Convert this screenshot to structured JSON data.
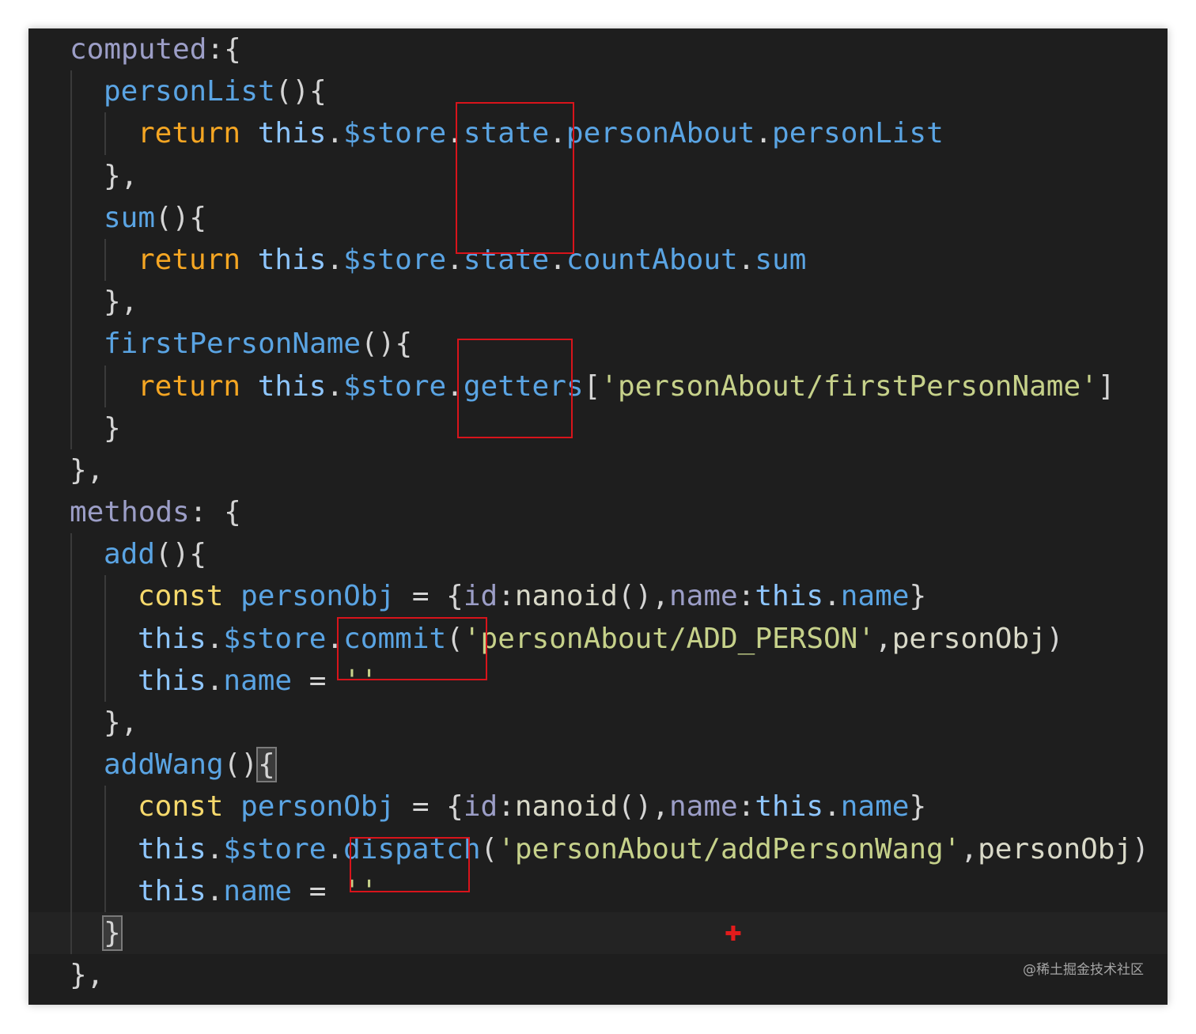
{
  "colors": {
    "editor_background": "#1e1e1e",
    "annotation_box": "#d8141b"
  },
  "code_lines": [
    [
      {
        "t": "computed",
        "c": "kw-prop"
      },
      {
        "t": ":{",
        "c": "punc"
      }
    ],
    [
      {
        "t": "personList",
        "c": "fn"
      },
      {
        "t": "(){",
        "c": "punc"
      }
    ],
    [
      {
        "t": "return",
        "c": "ret"
      },
      {
        "t": " ",
        "c": "punc"
      },
      {
        "t": "this",
        "c": "this"
      },
      {
        "t": ".",
        "c": "punc"
      },
      {
        "t": "$store",
        "c": "var"
      },
      {
        "t": ".",
        "c": "punc"
      },
      {
        "t": "state",
        "c": "var"
      },
      {
        "t": ".",
        "c": "punc"
      },
      {
        "t": "personAbout",
        "c": "var"
      },
      {
        "t": ".",
        "c": "punc"
      },
      {
        "t": "personList",
        "c": "var"
      }
    ],
    [
      {
        "t": "},",
        "c": "punc"
      }
    ],
    [
      {
        "t": "sum",
        "c": "fn"
      },
      {
        "t": "(){",
        "c": "punc"
      }
    ],
    [
      {
        "t": "return",
        "c": "ret"
      },
      {
        "t": " ",
        "c": "punc"
      },
      {
        "t": "this",
        "c": "this"
      },
      {
        "t": ".",
        "c": "punc"
      },
      {
        "t": "$store",
        "c": "var"
      },
      {
        "t": ".",
        "c": "punc"
      },
      {
        "t": "state",
        "c": "var"
      },
      {
        "t": ".",
        "c": "punc"
      },
      {
        "t": "countAbout",
        "c": "var"
      },
      {
        "t": ".",
        "c": "punc"
      },
      {
        "t": "sum",
        "c": "var"
      }
    ],
    [
      {
        "t": "},",
        "c": "punc"
      }
    ],
    [
      {
        "t": "firstPersonName",
        "c": "fn"
      },
      {
        "t": "(){",
        "c": "punc"
      }
    ],
    [
      {
        "t": "return",
        "c": "ret"
      },
      {
        "t": " ",
        "c": "punc"
      },
      {
        "t": "this",
        "c": "this"
      },
      {
        "t": ".",
        "c": "punc"
      },
      {
        "t": "$store",
        "c": "var"
      },
      {
        "t": ".",
        "c": "punc"
      },
      {
        "t": "getters",
        "c": "var"
      },
      {
        "t": "[",
        "c": "punc"
      },
      {
        "t": "'personAbout/firstPersonName'",
        "c": "str"
      },
      {
        "t": "]",
        "c": "punc"
      }
    ],
    [
      {
        "t": "}",
        "c": "punc"
      }
    ],
    [
      {
        "t": "},",
        "c": "punc"
      }
    ],
    [
      {
        "t": "methods",
        "c": "kw-prop"
      },
      {
        "t": ": {",
        "c": "punc"
      }
    ],
    [
      {
        "t": "add",
        "c": "fn"
      },
      {
        "t": "(){",
        "c": "punc"
      }
    ],
    [
      {
        "t": "const",
        "c": "const"
      },
      {
        "t": " ",
        "c": "punc"
      },
      {
        "t": "personObj",
        "c": "var"
      },
      {
        "t": " = {",
        "c": "punc"
      },
      {
        "t": "id",
        "c": "objkey"
      },
      {
        "t": ":",
        "c": "punc"
      },
      {
        "t": "nanoid",
        "c": "call"
      },
      {
        "t": "(),",
        "c": "punc"
      },
      {
        "t": "name",
        "c": "objkey"
      },
      {
        "t": ":",
        "c": "punc"
      },
      {
        "t": "this",
        "c": "this"
      },
      {
        "t": ".",
        "c": "punc"
      },
      {
        "t": "name",
        "c": "var"
      },
      {
        "t": "}",
        "c": "punc"
      }
    ],
    [
      {
        "t": "this",
        "c": "this"
      },
      {
        "t": ".",
        "c": "punc"
      },
      {
        "t": "$store",
        "c": "var"
      },
      {
        "t": ".",
        "c": "punc"
      },
      {
        "t": "commit",
        "c": "var"
      },
      {
        "t": "(",
        "c": "punc"
      },
      {
        "t": "'personAbout/ADD_PERSON'",
        "c": "str"
      },
      {
        "t": ",",
        "c": "punc"
      },
      {
        "t": "personObj",
        "c": "call"
      },
      {
        "t": ")",
        "c": "punc"
      }
    ],
    [
      {
        "t": "this",
        "c": "this"
      },
      {
        "t": ".",
        "c": "punc"
      },
      {
        "t": "name",
        "c": "var"
      },
      {
        "t": " = ",
        "c": "punc"
      },
      {
        "t": "''",
        "c": "str"
      }
    ],
    [
      {
        "t": "},",
        "c": "punc"
      }
    ],
    [
      {
        "t": "addWang",
        "c": "fn"
      },
      {
        "t": "()",
        "c": "punc"
      },
      {
        "t": "{",
        "c": "punc",
        "h": true
      }
    ],
    [
      {
        "t": "const",
        "c": "const"
      },
      {
        "t": " ",
        "c": "punc"
      },
      {
        "t": "personObj",
        "c": "var"
      },
      {
        "t": " = {",
        "c": "punc"
      },
      {
        "t": "id",
        "c": "objkey"
      },
      {
        "t": ":",
        "c": "punc"
      },
      {
        "t": "nanoid",
        "c": "call"
      },
      {
        "t": "(),",
        "c": "punc"
      },
      {
        "t": "name",
        "c": "objkey"
      },
      {
        "t": ":",
        "c": "punc"
      },
      {
        "t": "this",
        "c": "this"
      },
      {
        "t": ".",
        "c": "punc"
      },
      {
        "t": "name",
        "c": "var"
      },
      {
        "t": "}",
        "c": "punc"
      }
    ],
    [
      {
        "t": "this",
        "c": "this"
      },
      {
        "t": ".",
        "c": "punc"
      },
      {
        "t": "$store",
        "c": "var"
      },
      {
        "t": ".",
        "c": "punc"
      },
      {
        "t": "dispatch",
        "c": "var"
      },
      {
        "t": "(",
        "c": "punc"
      },
      {
        "t": "'personAbout/addPersonWang'",
        "c": "str"
      },
      {
        "t": ",",
        "c": "punc"
      },
      {
        "t": "personObj",
        "c": "call"
      },
      {
        "t": ")",
        "c": "punc"
      }
    ],
    [
      {
        "t": "this",
        "c": "this"
      },
      {
        "t": ".",
        "c": "punc"
      },
      {
        "t": "name",
        "c": "var"
      },
      {
        "t": " = ",
        "c": "punc"
      },
      {
        "t": "''",
        "c": "str"
      }
    ],
    [
      {
        "t": "}",
        "c": "punc",
        "h": true
      }
    ],
    [
      {
        "t": "},",
        "c": "punc"
      }
    ]
  ],
  "watermark": "@稀土掘金技术社区"
}
